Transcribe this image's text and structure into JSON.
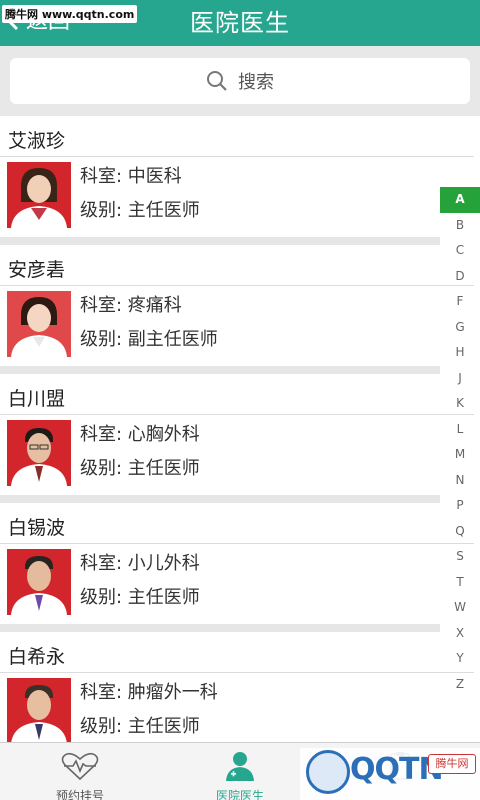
{
  "header": {
    "title": "医院医生",
    "back_label": "返回"
  },
  "watermark": {
    "text": "腾牛网 www.qqtn.com"
  },
  "search": {
    "placeholder": "搜索"
  },
  "doctors": [
    {
      "name": "艾淑珍",
      "dept": "科室: 中医科",
      "level": "级别: 主任医师",
      "gender": "female",
      "shirt": "#c23a4a"
    },
    {
      "name": "安彦砉",
      "dept": "科室: 疼痛科",
      "level": "级别: 副主任医师",
      "gender": "female",
      "shirt": "#ffffff"
    },
    {
      "name": "白川盟",
      "dept": "科室: 心胸外科",
      "level": "级别: 主任医师",
      "gender": "male",
      "shirt": "#8a2c2c"
    },
    {
      "name": "白锡波",
      "dept": "科室: 小儿外科",
      "level": "级别: 主任医师",
      "gender": "male",
      "shirt": "#6b4aa8"
    },
    {
      "name": "白希永",
      "dept": "科室: 肿瘤外一科",
      "level": "级别: 主任医师",
      "gender": "male",
      "shirt": "#3a3a6a"
    }
  ],
  "index_letters": [
    "A",
    "B",
    "C",
    "D",
    "F",
    "G",
    "H",
    "J",
    "K",
    "L",
    "M",
    "N",
    "P",
    "Q",
    "S",
    "T",
    "W",
    "X",
    "Y",
    "Z"
  ],
  "index_active": "A",
  "bottom_nav": [
    {
      "label": "预约挂号",
      "icon": "heartbeat-icon",
      "active": false
    },
    {
      "label": "医院医生",
      "icon": "doctor-icon",
      "active": true
    },
    {
      "label": "",
      "icon": "clipboard-icon",
      "active": false
    }
  ],
  "corner_logo": {
    "brand": "QQTN",
    "tag": "腾牛网"
  },
  "colors": {
    "header": "#27a68f",
    "index_active": "#26a23a",
    "photo_bg": "#d2262c"
  }
}
